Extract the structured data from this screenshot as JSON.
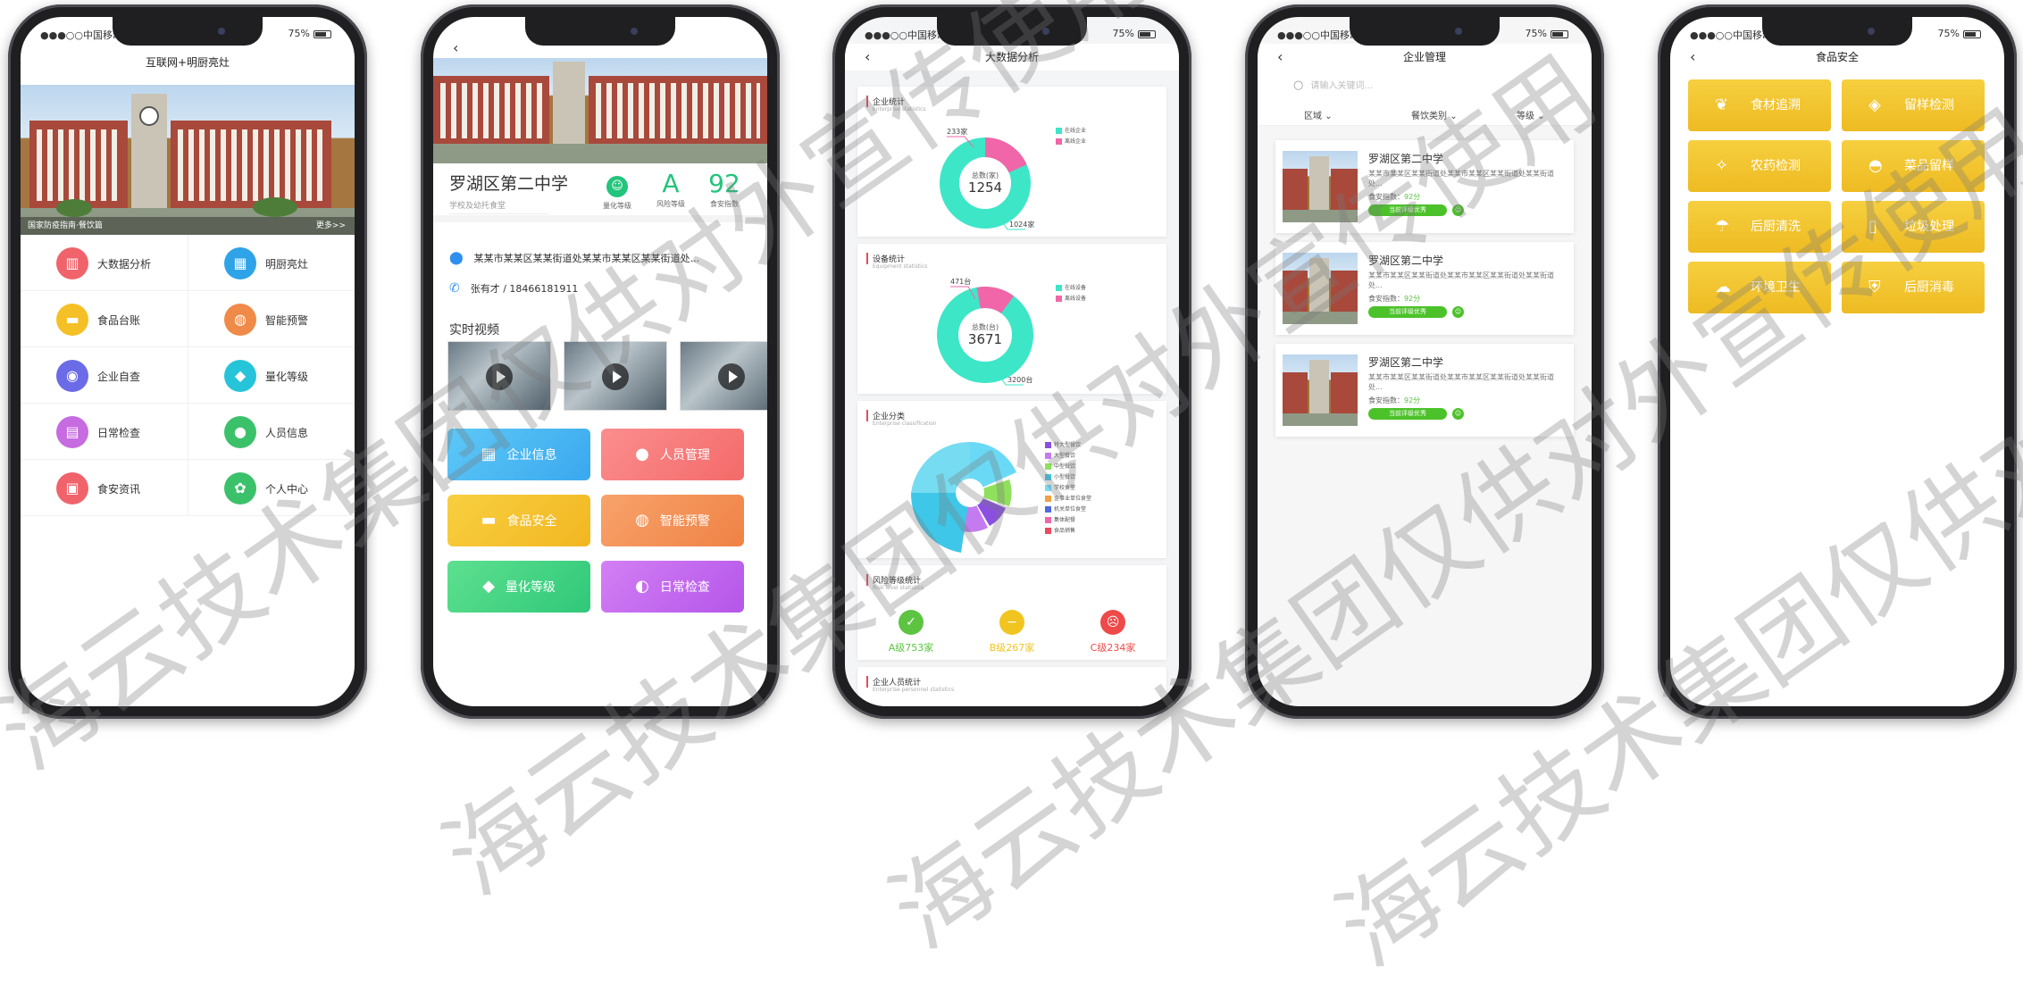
{
  "status_bar": {
    "carrier": "●●●○○中国移动",
    "battery": "75%"
  },
  "phone1": {
    "title": "互联网+明厨亮灶",
    "banner_caption": "国家防疫指南·餐饮篇",
    "banner_more": "更多>>",
    "menu": [
      {
        "label": "大数据分析",
        "icon": "chart-icon",
        "glyph": "▥",
        "color": "#f0636b"
      },
      {
        "label": "明厨亮灶",
        "icon": "building-icon",
        "glyph": "▦",
        "color": "#2ea3e8"
      },
      {
        "label": "食品台账",
        "icon": "burger-icon",
        "glyph": "▬",
        "color": "#f5c025"
      },
      {
        "label": "智能预警",
        "icon": "chef-icon",
        "glyph": "◍",
        "color": "#f08a48"
      },
      {
        "label": "企业自查",
        "icon": "user-check-icon",
        "glyph": "◉",
        "color": "#6b6be8"
      },
      {
        "label": "量化等级",
        "icon": "diamond-icon",
        "glyph": "◆",
        "color": "#26c4d9"
      },
      {
        "label": "日常检查",
        "icon": "checklist-icon",
        "glyph": "▤",
        "color": "#c66be0"
      },
      {
        "label": "人员信息",
        "icon": "person-icon",
        "glyph": "●",
        "color": "#3bc16a"
      },
      {
        "label": "食安资讯",
        "icon": "news-icon",
        "glyph": "▣",
        "color": "#f0636b"
      },
      {
        "label": "个人中心",
        "icon": "settings-icon",
        "glyph": "✿",
        "color": "#3bc16a"
      }
    ]
  },
  "phone2": {
    "school_name": "罗湖区第二中学",
    "school_type": "学校及幼托食堂",
    "metrics": [
      {
        "value": "",
        "label": "量化等级",
        "kind": "face"
      },
      {
        "value": "A",
        "label": "风险等级",
        "kind": "text"
      },
      {
        "value": "92",
        "label": "食安指数",
        "kind": "text"
      }
    ],
    "address": "某某市某某区某某街道处某某市某某区某某街道处...",
    "contact": "张有才 / 18466181911",
    "video_title": "实时视频",
    "tiles": [
      {
        "label": "企业信息",
        "icon": "building-icon",
        "glyph": "▦",
        "bg": "linear-gradient(135deg,#5ec8f7,#3aa8ee)"
      },
      {
        "label": "人员管理",
        "icon": "person-icon",
        "glyph": "●",
        "bg": "linear-gradient(135deg,#fb8e8e,#f46a6a)"
      },
      {
        "label": "食品安全",
        "icon": "burger-icon",
        "glyph": "▬",
        "bg": "linear-gradient(135deg,#f8cf40,#f2b722)"
      },
      {
        "label": "智能预警",
        "icon": "chef-icon",
        "glyph": "◍",
        "bg": "linear-gradient(135deg,#f7a36b,#f08245)"
      },
      {
        "label": "量化等级",
        "icon": "diamond-icon",
        "glyph": "◆",
        "bg": "linear-gradient(135deg,#5de08f,#30c87a)"
      },
      {
        "label": "日常检查",
        "icon": "inspector-icon",
        "glyph": "◐",
        "bg": "linear-gradient(135deg,#d37ff4,#b456ea)"
      }
    ]
  },
  "phone3": {
    "title": "大数据分析",
    "enterprise": {
      "title": "企业统计",
      "subtitle": "Enterprise statistics",
      "center_label": "总数(家)",
      "center_value": "1254",
      "callout_top": "233家",
      "callout_bottom": "1024家",
      "legend": [
        "在线企业",
        "离线企业"
      ]
    },
    "device": {
      "title": "设备统计",
      "subtitle": "Equipment statistics",
      "center_label": "总数(台)",
      "center_value": "3671",
      "callout_top": "471台",
      "callout_bottom": "3200台",
      "legend": [
        "在线设备",
        "离线设备"
      ]
    },
    "category": {
      "title": "企业分类",
      "subtitle": "Enterprise classification",
      "legend": [
        "特大型餐饮",
        "大型餐饮",
        "中型餐饮",
        "小型餐饮",
        "学校食堂",
        "企事业单位食堂",
        "机关单位食堂",
        "集体配餐",
        "食品销售"
      ]
    },
    "risk": {
      "title": "风险等级统计",
      "subtitle": "Risk level statistics",
      "levels": [
        {
          "label": "A级753家",
          "color": "#5dc441"
        },
        {
          "label": "B级267家",
          "color": "#f0c520"
        },
        {
          "label": "C级234家",
          "color": "#ef4a4a"
        }
      ]
    },
    "staff": {
      "title": "企业人员统计",
      "subtitle": "Enterprise personnel statistics"
    }
  },
  "phone4": {
    "title": "企业管理",
    "search_placeholder": "请输入关键词...",
    "filters": [
      "区域",
      "餐饮类别",
      "等级"
    ],
    "entries": [
      {
        "name": "罗湖区第二中学",
        "address": "某某市某某区某某街道处某某市某某区某某街道处某某街道处...",
        "score_label": "食安指数：",
        "score": "92分",
        "badge": "当前评级优秀"
      },
      {
        "name": "罗湖区第二中学",
        "address": "某某市某某区某某街道处某某市某某区某某街道处某某街道处...",
        "score_label": "食安指数：",
        "score": "92分",
        "badge": "当前评级优秀"
      },
      {
        "name": "罗湖区第二中学",
        "address": "某某市某某区某某街道处某某市某某区某某街道处某某街道处...",
        "score_label": "食安指数：",
        "score": "92分",
        "badge": "当前评级优秀"
      }
    ]
  },
  "phone5": {
    "title": "食品安全",
    "tiles": [
      {
        "label": "食材追溯",
        "icon": "leaf-icon",
        "glyph": "❦"
      },
      {
        "label": "留样检测",
        "icon": "test-icon",
        "glyph": "◈"
      },
      {
        "label": "农药检测",
        "icon": "pesticide-icon",
        "glyph": "✧"
      },
      {
        "label": "菜品留样",
        "icon": "dish-icon",
        "glyph": "◓"
      },
      {
        "label": "后厨清洗",
        "icon": "wash-icon",
        "glyph": "☂"
      },
      {
        "label": "垃圾处理",
        "icon": "trash-icon",
        "glyph": "▯"
      },
      {
        "label": "环境卫生",
        "icon": "environment-icon",
        "glyph": "☁"
      },
      {
        "label": "后厨消毒",
        "icon": "disinfect-icon",
        "glyph": "⛨"
      }
    ]
  },
  "watermark": "海云技术集团仅供对外宣传使用"
}
